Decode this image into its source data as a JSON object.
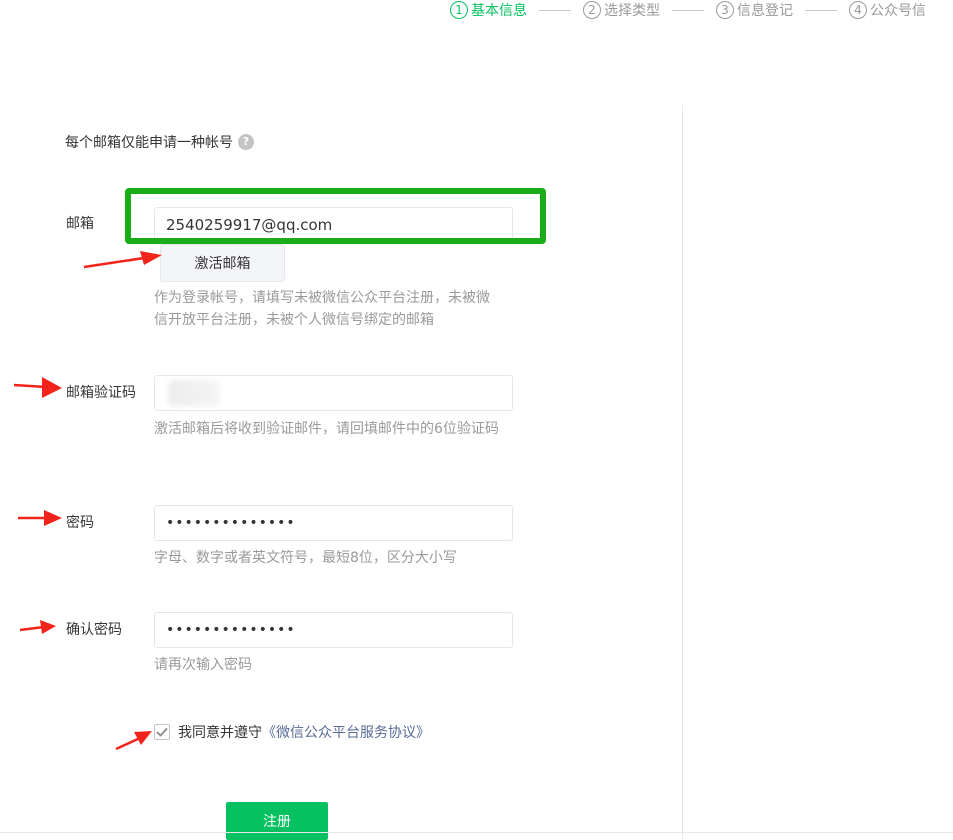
{
  "steps": [
    {
      "num": "1",
      "label": "基本信息"
    },
    {
      "num": "2",
      "label": "选择类型"
    },
    {
      "num": "3",
      "label": "信息登记"
    },
    {
      "num": "4",
      "label": "公众号信"
    }
  ],
  "note": {
    "text": "每个邮箱仅能申请一种帐号",
    "help_icon": "?"
  },
  "email": {
    "label": "邮箱",
    "value": "2540259917@qq.com",
    "activate_button": "激活邮箱",
    "tip": "作为登录帐号，请填写未被微信公众平台注册，未被微信开放平台注册，未被个人微信号绑定的邮箱"
  },
  "code": {
    "label": "邮箱验证码",
    "tip": "激活邮箱后将收到验证邮件，请回填邮件中的6位验证码"
  },
  "password": {
    "label": "密码",
    "value": "••••••••••••••",
    "tip": "字母、数字或者英文符号，最短8位，区分大小写"
  },
  "confirm": {
    "label": "确认密码",
    "value": "••••••••••••••",
    "tip": "请再次输入密码"
  },
  "agreement": {
    "checked": true,
    "prefix": "我同意并遵守",
    "link": "《微信公众平台服务协议》"
  },
  "register_button": "注册",
  "colors": {
    "accent": "#07c160",
    "highlight_box": "#1aad19",
    "annotation_arrow": "#f0241b",
    "link": "#576b95"
  }
}
